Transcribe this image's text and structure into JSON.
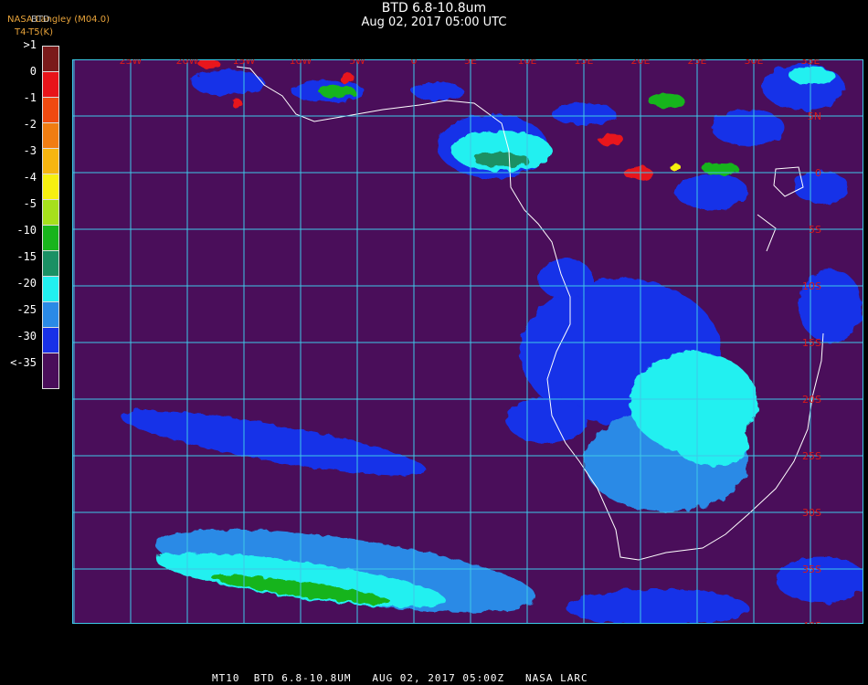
{
  "header": {
    "title": "BTD 6.8-10.8um",
    "subtitle": "Aug 02, 2017 05:00 UTC",
    "credit": "NASA Langley (M04.0)",
    "unit_label": "T4-T5(K)",
    "bt_label": "BTD"
  },
  "legend": {
    "labels": [
      ">1",
      "0",
      "-1",
      "-2",
      "-3",
      "-4",
      "-5",
      "-10",
      "-15",
      "-20",
      "-25",
      "-30",
      "<-35"
    ],
    "colors": [
      "#7a1a1a",
      "#e8141a",
      "#f04a10",
      "#f07d12",
      "#f6b510",
      "#f6f010",
      "#a6e01c",
      "#18b41c",
      "#1a9064",
      "#22f0f0",
      "#2a8ae6",
      "#1830e8",
      "#4a0e5a"
    ]
  },
  "map": {
    "background": "#4a0e5a",
    "grid_color": "#3ec8e8",
    "label_color": "#d81a1a",
    "longitude_labels": [
      "25W",
      "20W",
      "15W",
      "10W",
      "5W",
      "0",
      "5E",
      "10E",
      "15E",
      "20E",
      "25E",
      "30E",
      "35E"
    ],
    "latitude_labels": [
      "5N",
      "0",
      "5S",
      "10S",
      "15S",
      "20S",
      "25S",
      "30S",
      "35S",
      "40S"
    ]
  },
  "footer": {
    "text": "MT10  BTD 6.8-10.8UM   AUG 02, 2017 05:00Z   NASA LARC"
  }
}
